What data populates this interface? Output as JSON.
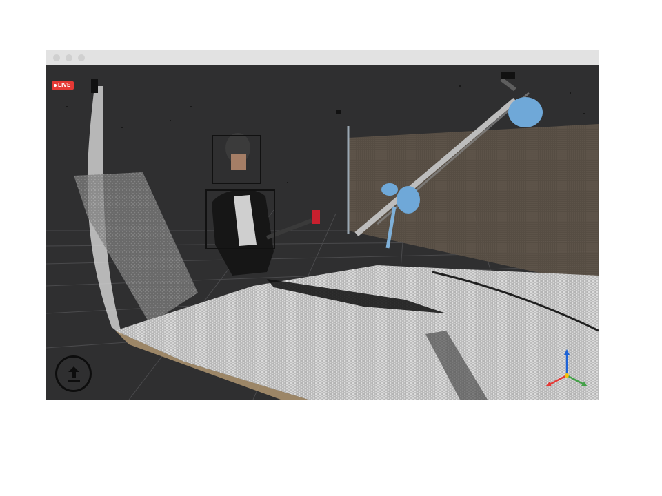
{
  "window": {
    "titlebar_buttons": [
      "close",
      "minimize",
      "maximize"
    ]
  },
  "viewer": {
    "live_badge": "LIVE",
    "detections": [
      {
        "label": "face"
      },
      {
        "label": "body"
      }
    ],
    "upload_button_icon": "upload-icon",
    "axis_gizmo_icon": "xyz-axes-icon",
    "colors": {
      "background": "#2f2f30",
      "live": "#e53935",
      "axis_x": "#e53935",
      "axis_y": "#43a047",
      "axis_z": "#1e63d6",
      "arm_blue": "#6fa8d8"
    }
  }
}
